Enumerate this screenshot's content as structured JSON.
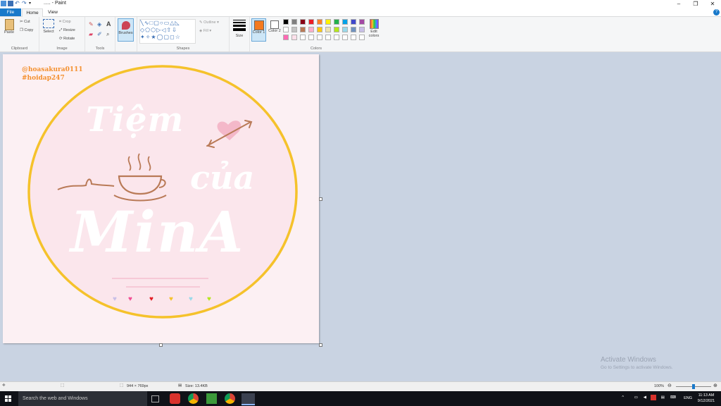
{
  "window": {
    "title": "..... - Paint",
    "controls": [
      "–",
      "❐",
      "✕"
    ]
  },
  "tabs": [
    {
      "label": "File"
    },
    {
      "label": "Home"
    },
    {
      "label": "View"
    }
  ],
  "ribbon": {
    "clipboard": {
      "paste": "Paste",
      "cut": "Cut",
      "copy": "Copy",
      "label": "Clipboard"
    },
    "image": {
      "select": "Select",
      "crop": "Crop",
      "resize": "Resize",
      "rotate": "Rotate",
      "label": "Image"
    },
    "tools": {
      "label": "Tools"
    },
    "brushes": {
      "label": "Brushes"
    },
    "shapes": {
      "outline": "Outline",
      "fill": "Fill",
      "label": "Shapes"
    },
    "size": {
      "label": "Size"
    },
    "colors": {
      "color1": "Color 1",
      "color2": "Color 2",
      "edit": "Edit colors",
      "label": "Colors",
      "color1_value": "#f47a20",
      "color2_value": "#ffffff",
      "palette": [
        "#000000",
        "#7f7f7f",
        "#880015",
        "#ed1c24",
        "#ff7f27",
        "#fff200",
        "#22b14c",
        "#00a2e8",
        "#3f48cc",
        "#a349a4",
        "#ffffff",
        "#c3c3c3",
        "#b97a57",
        "#ffaec9",
        "#ffc90e",
        "#efe4b0",
        "#b5e61d",
        "#99d9ea",
        "#7092be",
        "#c8bfe7",
        "#ff69b4",
        "#fde0ea",
        "#ffffff",
        "#ffffff",
        "#ffffff",
        "#ffffff",
        "#ffffff",
        "#ffffff",
        "#ffffff",
        "#ffffff"
      ]
    }
  },
  "canvas": {
    "watermark_user": "@hoasakura0111",
    "watermark_tag": "#hoidap247",
    "logo_text": [
      "Tiệm",
      "của",
      "MinA"
    ],
    "accent_ring": "#f5c22b",
    "hearts": [
      "#c8bfe7",
      "#f14e93",
      "#e31b23",
      "#f5c22b",
      "#99d9ea",
      "#b5e61d"
    ]
  },
  "watermark": {
    "line1": "Activate Windows",
    "line2": "Go to Settings to activate Windows."
  },
  "status": {
    "dimensions": "944 × 769px",
    "size": "Size: 13.4KB",
    "zoom": "100%"
  },
  "taskbar": {
    "search_placeholder": "Search the web and Windows",
    "lang": "ENG",
    "time": "11:13 AM",
    "date": "9/12/2021"
  }
}
